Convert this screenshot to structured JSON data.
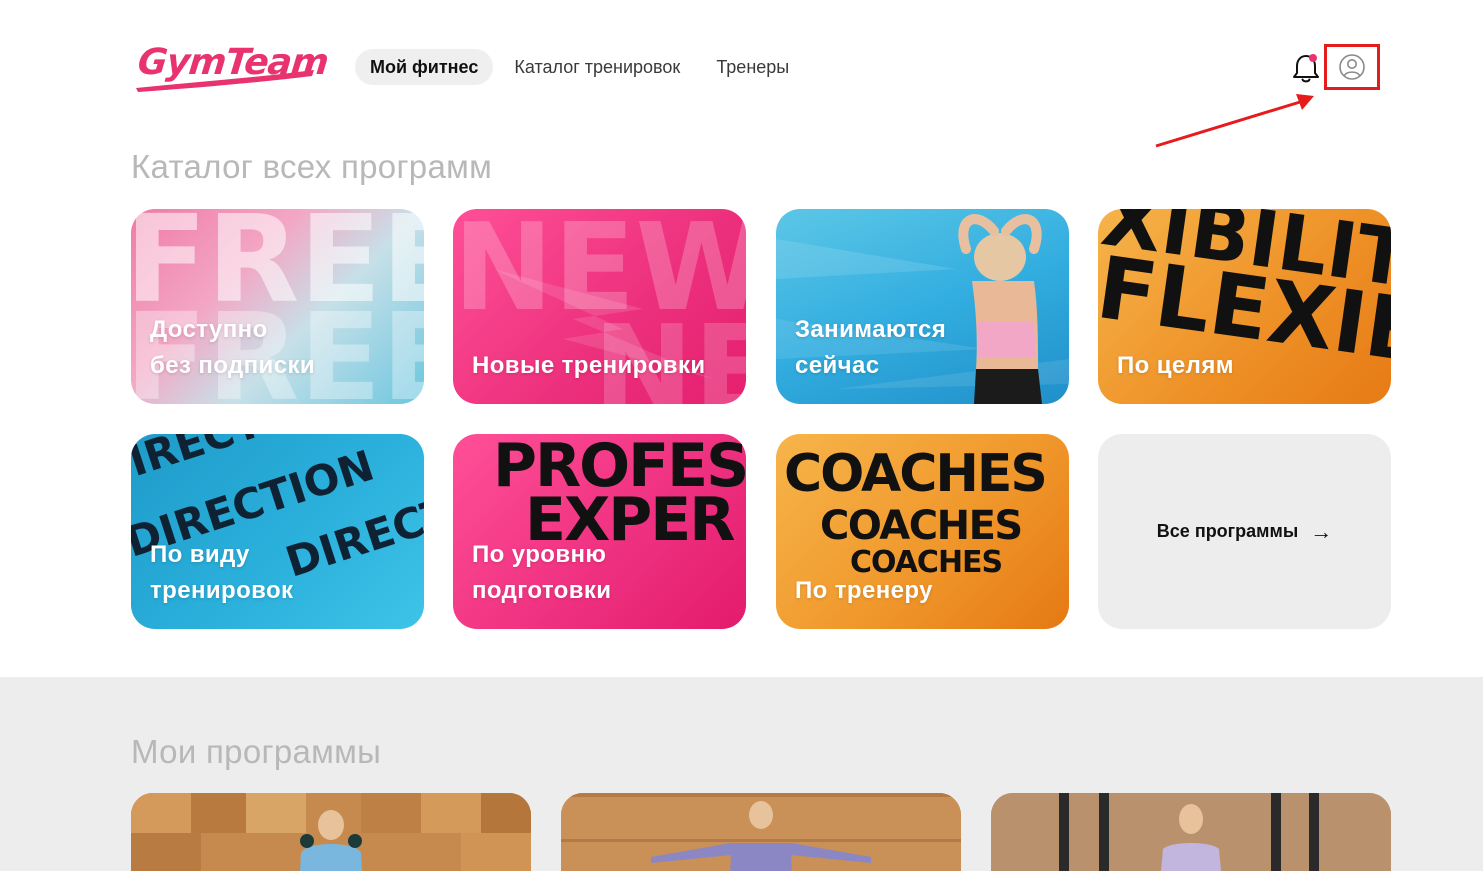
{
  "header": {
    "logo_text": "GymTeam",
    "nav": [
      {
        "label": "Мой фитнес",
        "active": true
      },
      {
        "label": "Каталог тренировок",
        "active": false
      },
      {
        "label": "Тренеры",
        "active": false
      }
    ],
    "icons": {
      "notifications": "bell-icon",
      "profile": "user-circle-icon"
    }
  },
  "catalog": {
    "title": "Каталог всех программ",
    "cards": [
      {
        "line1": "Доступно",
        "line2": "без подписки",
        "bg_word": "FREE"
      },
      {
        "line1": "Новые тренировки",
        "line2": "",
        "bg_word": "NEW"
      },
      {
        "line1": "Занимаются",
        "line2": "сейчас"
      },
      {
        "line1": "По целям",
        "line2": "",
        "bg_word": "FLEXIB",
        "bg_word_2": "XIBILIT"
      },
      {
        "line1": "По виду",
        "line2": "тренировок",
        "bg_word": "DIRECTION"
      },
      {
        "line1": "По уровню",
        "line2": "подготовки",
        "bg_word": "PROFES",
        "bg_word_2": "EXPER"
      },
      {
        "line1": "По тренеру",
        "line2": "",
        "bg_word": "COACHES"
      }
    ],
    "all_label": "Все программы",
    "all_arrow": "→"
  },
  "my_programs": {
    "title": "Мои программы"
  },
  "colors": {
    "brand": "#e8336f",
    "annotation": "#e61c1c"
  }
}
